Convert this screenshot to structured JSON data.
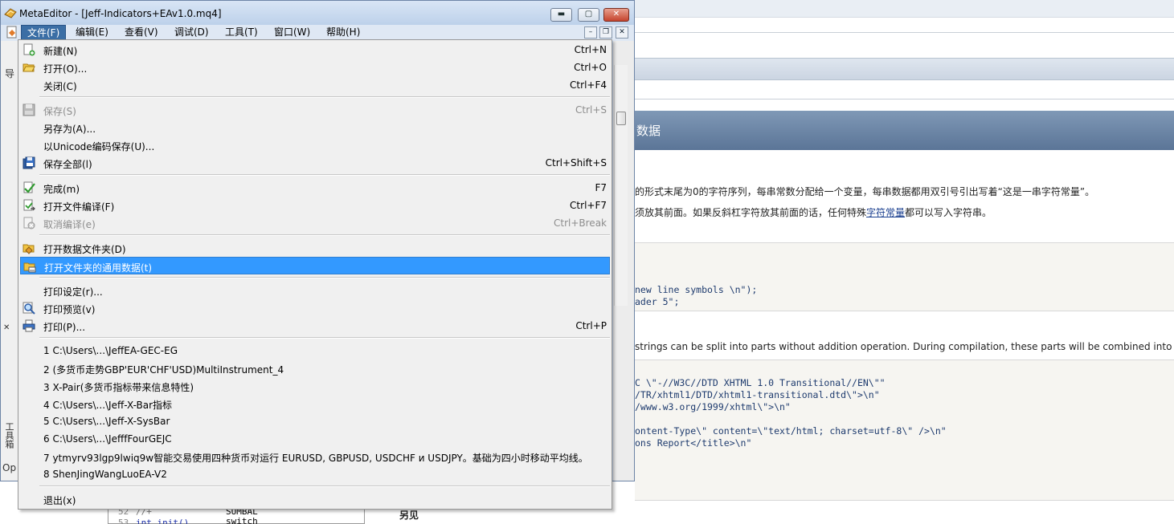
{
  "window": {
    "title": "MetaEditor - [Jeff-Indicators+EAv1.0.mq4]",
    "minimize_glyph": "▬",
    "maximize_glyph": "▢",
    "close_glyph": "✕"
  },
  "menubar": {
    "items": [
      "文件(F)",
      "编辑(E)",
      "查看(V)",
      "调试(D)",
      "工具(T)",
      "窗口(W)",
      "帮助(H)"
    ],
    "active": "文件(F)",
    "mdi_minimize": "–",
    "mdi_restore": "❐",
    "mdi_close": "✕"
  },
  "file_menu": {
    "new": {
      "label": "新建(N)",
      "shortcut": "Ctrl+N",
      "icon": "new-file-icon"
    },
    "open": {
      "label": "打开(O)...",
      "shortcut": "Ctrl+O",
      "icon": "open-folder-icon"
    },
    "close": {
      "label": "关闭(C)",
      "shortcut": "Ctrl+F4"
    },
    "save": {
      "label": "保存(S)",
      "shortcut": "Ctrl+S",
      "icon": "save-icon"
    },
    "save_as": {
      "label": "另存为(A)..."
    },
    "save_unicode": {
      "label": "以Unicode编码保存(U)..."
    },
    "save_all": {
      "label": "保存全部(l)",
      "shortcut": "Ctrl+Shift+S",
      "icon": "save-all-icon"
    },
    "compile": {
      "label": "完成(m)",
      "shortcut": "F7",
      "icon": "compile-check-icon"
    },
    "compile_open": {
      "label": "打开文件编译(F)",
      "shortcut": "Ctrl+F7",
      "icon": "compile-open-icon"
    },
    "cancel_compile": {
      "label": "取消编译(e)",
      "shortcut": "Ctrl+Break",
      "icon": "cancel-compile-icon"
    },
    "open_data_folder": {
      "label": "打开数据文件夹(D)",
      "icon": "data-folder-icon"
    },
    "open_common_data": {
      "label": "打开文件夹的通用数据(t)",
      "icon": "common-folder-icon"
    },
    "print_setup": {
      "label": "打印设定(r)..."
    },
    "print_preview": {
      "label": "打印预览(v)",
      "icon": "print-preview-icon"
    },
    "print": {
      "label": "打印(P)...",
      "shortcut": "Ctrl+P",
      "icon": "printer-icon"
    },
    "recent": [
      "1 C:\\Users\\...\\JeffEA-GEC-EG",
      "2 (多货币走势GBP'EUR'CHF'USD)MultiInstrument_4",
      "3 X-Pair(多货币指标带来信息特性)",
      "4 C:\\Users\\...\\Jeff-X-Bar指标",
      "5 C:\\Users\\...\\Jeff-X-SysBar",
      "6 C:\\Users\\...\\JefffFourGEJC",
      "7 ytmyrv93lgp9lwiq9w智能交易使用四种货币对运行 EURUSD, GBPUSD, USDCHF и USDJPY。基础为四小时移动平均线。",
      "8 ShenJingWangLuoEA-V2"
    ],
    "exit": {
      "label": "退出(x)"
    }
  },
  "left_strip": {
    "nav_label": "导",
    "toolbox_label": "工具箱",
    "close_x": "✕",
    "op_label": "Op"
  },
  "editor": {
    "line_numbers": [
      "52",
      "53"
    ],
    "code": [
      "//+",
      "int init()"
    ],
    "side_words": [
      "SUMBAL",
      "switch"
    ]
  },
  "help_page": {
    "section_title": "数据",
    "para1": "的形式末尾为0的字符序列，每串常数分配给一个变量，每串数据都用双引号引出写着“这是一串字符常量”。",
    "para2_before": "须放其前面。如果反斜杠字符放其前面的话，任何特殊",
    "para2_link": "字符常量",
    "para2_after": "都可以写入字符串。",
    "code1": [
      "new line symbols \\n\");",
      "ader 5\";"
    ],
    "para3": "strings can be split into parts without addition operation. During compilation, these parts will be combined into one",
    "code2": [
      "C \\\"-//W3C//DTD XHTML 1.0 Transitional//EN\\\"\"",
      "/TR/xhtml1/DTD/xhtml1-transitional.dtd\\\">\\n\"",
      "/www.w3.org/1999/xhtml\\\">\\n\"",
      "",
      "ontent-Type\\\" content=\\\"text/html; charset=utf-8\\\" />\\n\"",
      "ons Report</title>\\n\""
    ],
    "see_also": "另见"
  }
}
